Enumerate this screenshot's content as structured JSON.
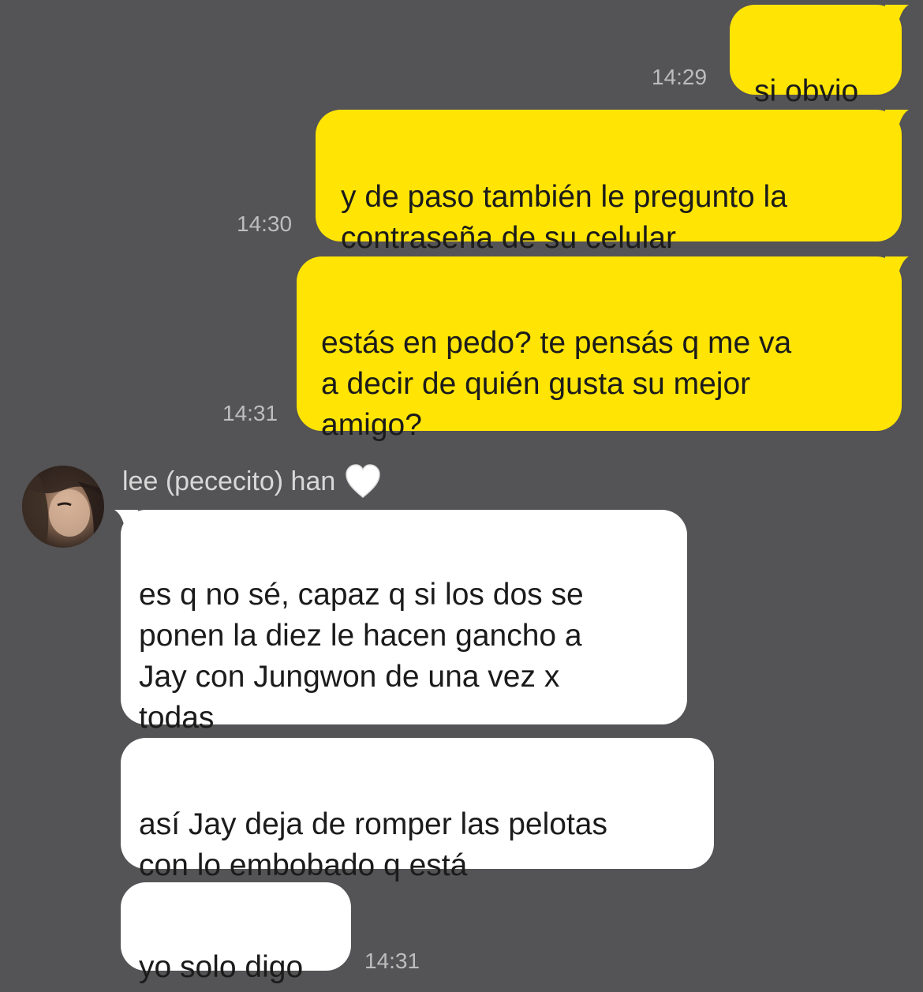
{
  "colors": {
    "background": "#545355",
    "outgoing_bubble": "#ffe404",
    "incoming_bubble": "#ffffff",
    "timestamp": "#bdbdbd",
    "sender_name": "#d8d8d8"
  },
  "outgoing": [
    {
      "text": "si obvio",
      "time": "14:29"
    },
    {
      "text": "y de paso también le pregunto la\ncontraseña de su celular",
      "time": "14:30"
    },
    {
      "text": "estás en pedo? te pensás q me va\na decir de quién gusta su mejor\namigo?",
      "time": "14:31"
    }
  ],
  "contact": {
    "name": "lee (pececito) han",
    "name_icon": "white-heart-icon"
  },
  "incoming": [
    {
      "text": "es q no sé, capaz q si los dos se\nponen la diez le hacen gancho a\nJay con Jungwon de una vez x\ntodas"
    },
    {
      "text": "así Jay deja de romper las pelotas\ncon lo embobado q está"
    },
    {
      "text": "yo solo digo",
      "time": "14:31"
    }
  ]
}
